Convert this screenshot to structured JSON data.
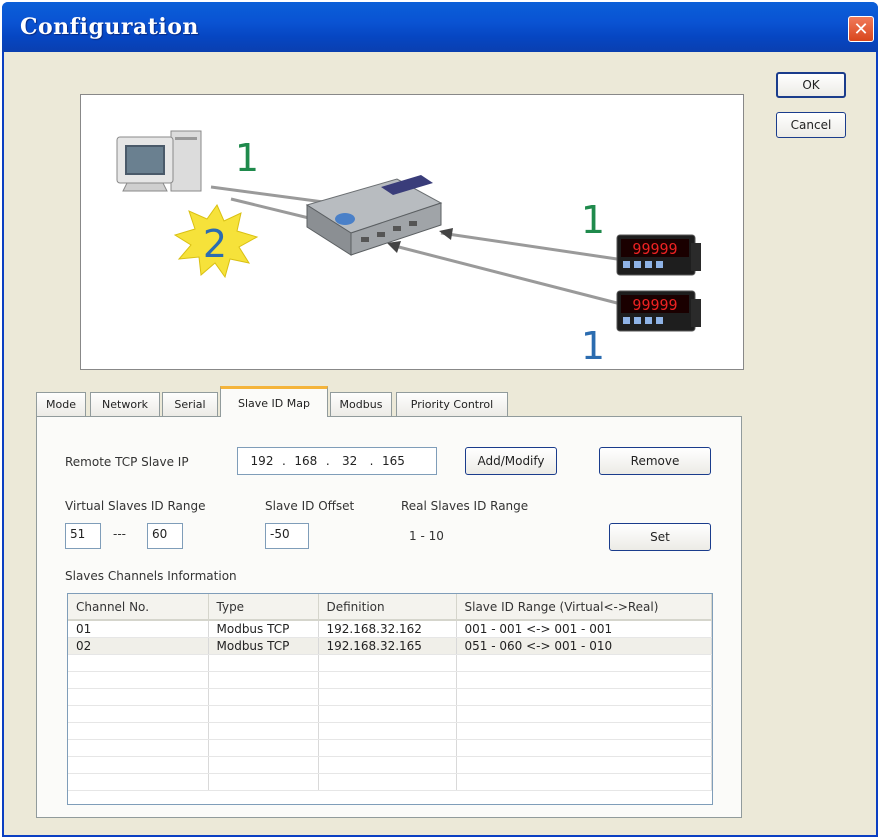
{
  "window": {
    "title": "Configuration",
    "close_glyph": "✕"
  },
  "buttons": {
    "ok": "OK",
    "cancel": "Cancel"
  },
  "diagram": {
    "labels": [
      "1",
      "2",
      "1",
      "1"
    ],
    "meter_readout": "99999",
    "colors": {
      "green": "#1f8a4c",
      "blue": "#1f6fb0",
      "burst": "#f6e23a"
    }
  },
  "tabs": [
    "Mode",
    "Network",
    "Serial",
    "Slave ID Map",
    "Modbus",
    "Priority Control"
  ],
  "active_tab": "Slave ID Map",
  "slave_map": {
    "remote_ip_label": "Remote TCP Slave IP",
    "ip": [
      "192",
      "168",
      "32",
      "165"
    ],
    "ip_dot": ".",
    "add_modify": "Add/Modify",
    "remove": "Remove",
    "virtual_range_label": "Virtual Slaves ID Range",
    "virtual_from": "51",
    "range_sep": "---",
    "virtual_to": "60",
    "offset_label": "Slave ID Offset",
    "offset": "-50",
    "real_range_label": "Real Slaves ID Range",
    "real_range": "1 - 10",
    "set": "Set",
    "channels_label": "Slaves Channels Information",
    "columns": [
      "Channel No.",
      "Type",
      "Definition",
      "Slave ID Range (Virtual<->Real)"
    ],
    "rows": [
      [
        "01",
        "Modbus TCP",
        "192.168.32.162",
        "001 - 001 <-> 001 - 001"
      ],
      [
        "02",
        "Modbus TCP",
        "192.168.32.165",
        "051 - 060 <-> 001 - 010"
      ]
    ]
  }
}
